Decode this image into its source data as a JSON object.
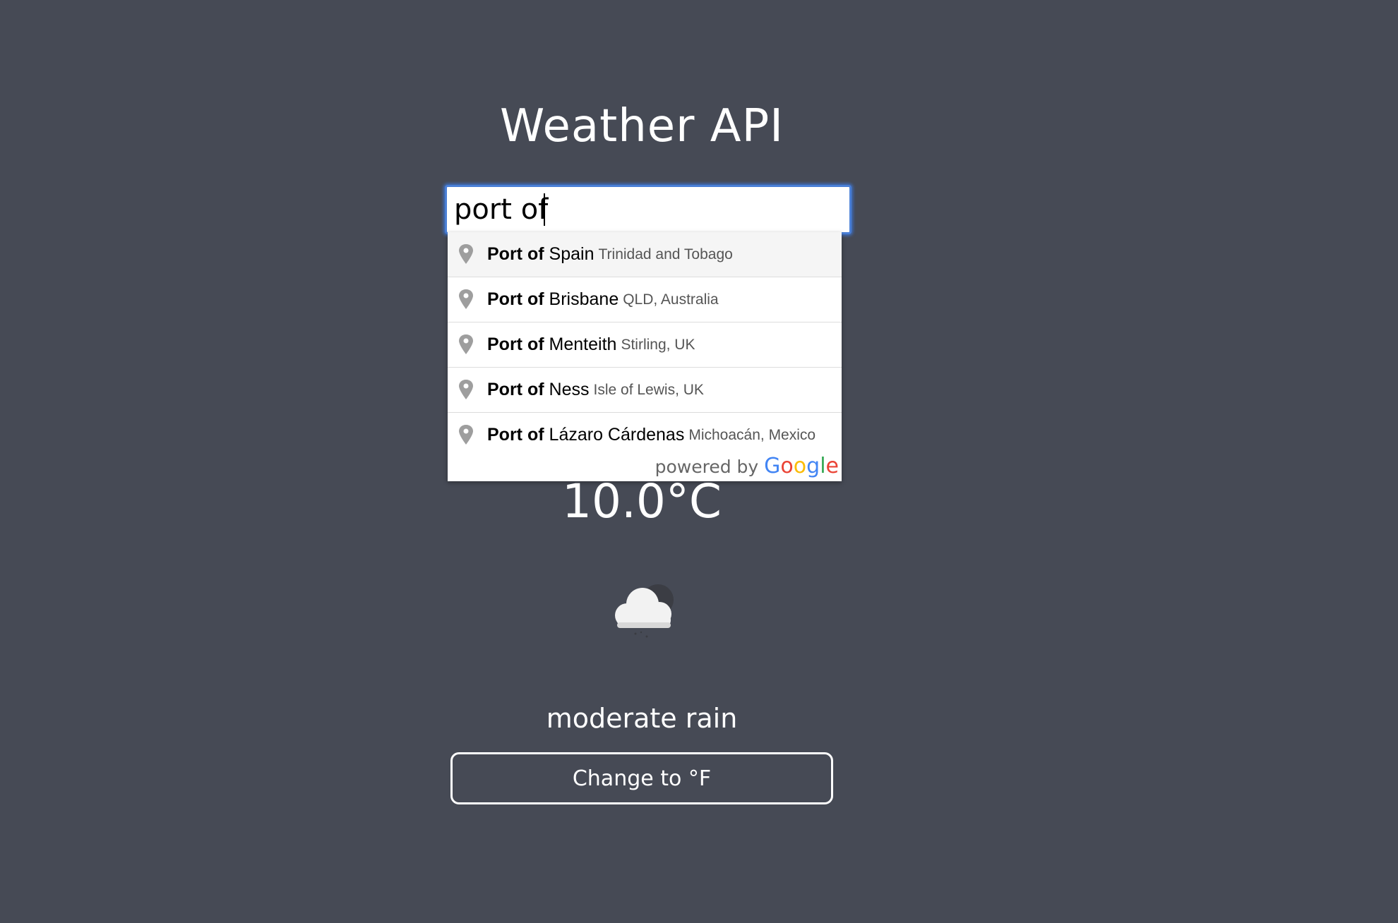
{
  "app": {
    "title": "Weather API"
  },
  "search": {
    "value": "port of ",
    "placeholder": ""
  },
  "suggestions": [
    {
      "match": "Port of",
      "rest": "Spain",
      "secondary": "Trinidad and Tobago"
    },
    {
      "match": "Port of",
      "rest": "Brisbane",
      "secondary": "QLD, Australia"
    },
    {
      "match": "Port of",
      "rest": "Menteith",
      "secondary": "Stirling, UK"
    },
    {
      "match": "Port of",
      "rest": "Ness",
      "secondary": "Isle of Lewis, UK"
    },
    {
      "match": "Port of",
      "rest": "Lázaro Cárdenas",
      "secondary": "Michoacán, Mexico"
    }
  ],
  "attribution": {
    "powered_by": "powered by",
    "brand": "Google",
    "brand_colors": [
      "#4285F4",
      "#EA4335",
      "#FBBC05",
      "#4285F4",
      "#34A853",
      "#EA4335"
    ]
  },
  "weather": {
    "temperature": "10.0°C",
    "condition": "moderate rain",
    "icon": "cloud-rain-icon"
  },
  "controls": {
    "unit_toggle_label": "Change to °F"
  },
  "colors": {
    "background": "#464a55",
    "focus_ring": "#4a7fd6",
    "text": "#ffffff"
  }
}
